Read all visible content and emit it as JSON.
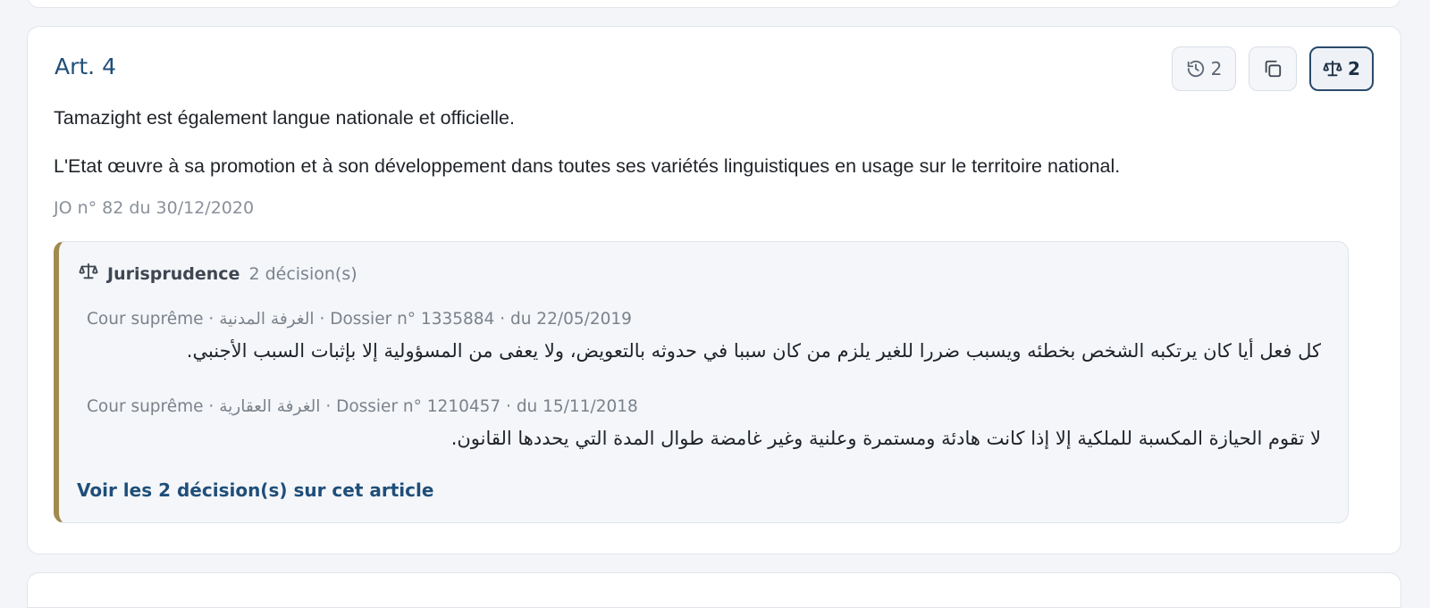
{
  "article": {
    "title": "Art. 4",
    "paragraphs": [
      "Tamazight est également langue nationale et officielle.",
      "L'Etat œuvre à sa promotion et à son développement dans toutes ses variétés linguistiques en usage sur le territoire national."
    ],
    "jo_reference": "JO n° 82 du 30/12/2020"
  },
  "toolbar": {
    "history_count": "2",
    "jurisprudence_count": "2",
    "icons": {
      "history": "history-icon",
      "copy": "copy-icon",
      "jurisprudence": "scales-icon"
    }
  },
  "jurisprudence": {
    "title": "Jurisprudence",
    "count_label": "2 décision(s)",
    "decisions": [
      {
        "meta": "Cour suprême · الغرفة المدنية · Dossier n° 1335884 · du 22/05/2019",
        "text": "كل فعل أيا كان يرتكبه الشخص بخطئه ويسبب ضررا للغير يلزم من كان سببا في حدوثه بالتعويض، ولا يعفى من المسؤولية إلا بإثبات السبب الأجنبي."
      },
      {
        "meta": "Cour suprême · الغرفة العقارية · Dossier n° 1210457 · du 15/11/2018",
        "text": "لا تقوم الحيازة المكسبة للملكية إلا إذا كانت هادئة ومستمرة وعلنية وغير غامضة طوال المدة التي يحددها القانون."
      }
    ],
    "see_all_link": "Voir les 2 décision(s) sur cet article"
  },
  "colors": {
    "title": "#1f4e79",
    "accent_border": "#a08a4e",
    "active_button_border": "#2b4a6a"
  }
}
